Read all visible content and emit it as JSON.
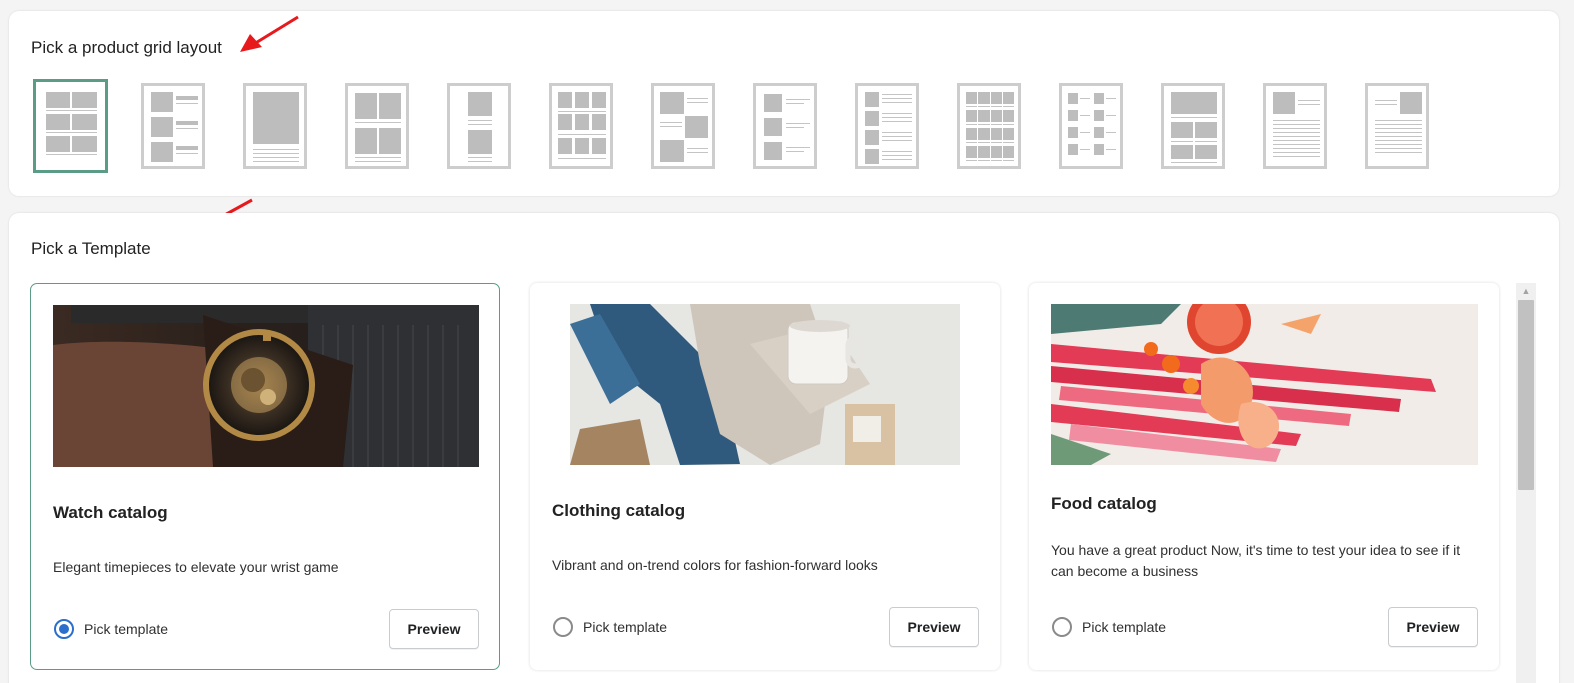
{
  "layout_section": {
    "title": "Pick a product grid layout",
    "options": [
      {
        "name": "grid-2x4",
        "selected": true
      },
      {
        "name": "list-image-left",
        "selected": false
      },
      {
        "name": "single-large",
        "selected": false
      },
      {
        "name": "grid-2x2",
        "selected": false
      },
      {
        "name": "single-narrow-stacked",
        "selected": false
      },
      {
        "name": "grid-3x3",
        "selected": false
      },
      {
        "name": "staggered",
        "selected": false
      },
      {
        "name": "list-small-image",
        "selected": false
      },
      {
        "name": "list-detailed",
        "selected": false
      },
      {
        "name": "grid-4x3",
        "selected": false
      },
      {
        "name": "grid-4x4-list",
        "selected": false
      },
      {
        "name": "grid-2x3",
        "selected": false
      },
      {
        "name": "image-top-text",
        "selected": false
      },
      {
        "name": "image-right-text",
        "selected": false
      }
    ]
  },
  "template_section": {
    "title": "Pick a Template",
    "templates": [
      {
        "name": "Watch catalog",
        "description": "Elegant timepieces to elevate your wrist game",
        "pick_label": "Pick template",
        "preview_label": "Preview",
        "selected": true
      },
      {
        "name": "Clothing catalog",
        "description": "Vibrant and on-trend colors for fashion-forward looks",
        "pick_label": "Pick template",
        "preview_label": "Preview",
        "selected": false
      },
      {
        "name": "Food catalog",
        "description": "You have a great product Now, it's time to test your idea to see if it can become a business",
        "pick_label": "Pick template",
        "preview_label": "Preview",
        "selected": false
      }
    ]
  },
  "colors": {
    "accent": "#5b9c86",
    "radio": "#2c6ecb",
    "annotation_arrow": "#e8191d"
  }
}
